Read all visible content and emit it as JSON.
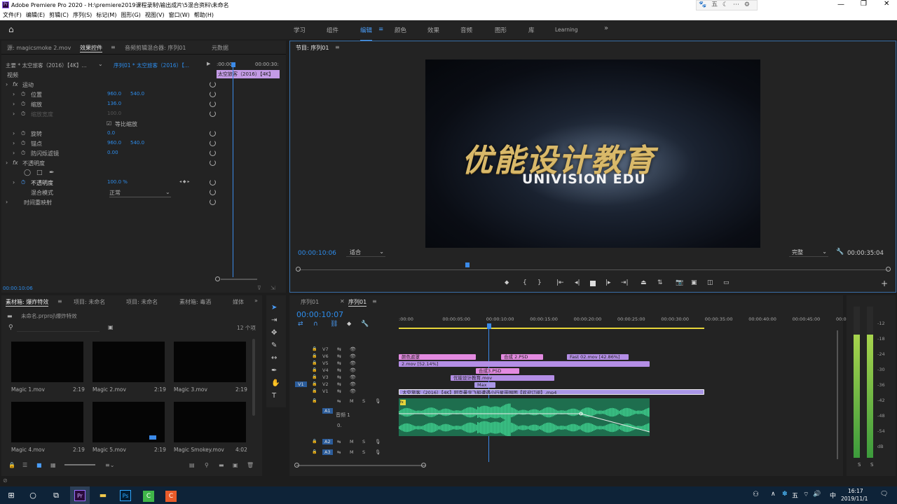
{
  "window": {
    "title": "Adobe Premiere Pro 2020 - H:\\premiere2019课程录制\\输出成片\\5混合资料\\未命名"
  },
  "menu": [
    "文件(F)",
    "编辑(E)",
    "剪辑(C)",
    "序列(S)",
    "标记(M)",
    "图形(G)",
    "视图(V)",
    "窗口(W)",
    "帮助(H)"
  ],
  "workspaces": [
    "学习",
    "组件",
    "编辑",
    "颜色",
    "效果",
    "音频",
    "图形",
    "库",
    "Learning"
  ],
  "active_workspace": "编辑",
  "ec": {
    "tabs": [
      "源: magicsmoke 2.mov",
      "效果控件",
      "音频剪辑混合器: 序列01",
      "元数据"
    ],
    "master": "主要 * 太空旅客（2016）【4K】...",
    "seq": "序列01 * 太空旅客（2016）【...",
    "ruler_start": ":00:00",
    "ruler_end": "00:00:30:",
    "clipbar": "太空旅客（2016）【4K】",
    "section_video": "视频",
    "rows": [
      {
        "label": "运动",
        "fx": true,
        "indent": 0
      },
      {
        "label": "位置",
        "v1": "960.0",
        "v2": "540.0",
        "indent": 1
      },
      {
        "label": "缩放",
        "v1": "136.0",
        "indent": 1
      },
      {
        "label": "缩放宽度",
        "v1": "100.0",
        "indent": 1,
        "dim": true
      },
      {
        "label": "等比缩放",
        "check": true,
        "indent": 2
      },
      {
        "label": "旋转",
        "v1": "0.0",
        "indent": 1
      },
      {
        "label": "锚点",
        "v1": "960.0",
        "v2": "540.0",
        "indent": 1
      },
      {
        "label": "防闪烁滤镜",
        "v1": "0.00",
        "indent": 1
      },
      {
        "label": "不透明度",
        "fx": true,
        "indent": 0
      },
      {
        "label": "",
        "shapes": true,
        "indent": 1
      },
      {
        "label": "不透明度",
        "v1": "100.0 %",
        "indent": 1,
        "kf": true
      },
      {
        "label": "混合模式",
        "select": "正常",
        "indent": 1
      },
      {
        "label": "时间重映射",
        "indent": 0
      }
    ],
    "timecode": "00:00:10:06"
  },
  "program": {
    "tab": "节目: 序列01",
    "timecode": "00:00:10:06",
    "fit": "适合",
    "quality": "完整",
    "duration": "00:00:35:04",
    "title_cn": "优能设计教育",
    "title_en": "UNIVISION EDU"
  },
  "project": {
    "tabs": [
      "素材箱: 爆炸特效",
      "项目: 未命名",
      "项目: 未命名",
      "素材箱: 毒酒",
      "媒体"
    ],
    "path": "未命名.prproj\\爆炸特效",
    "count": "12 个项",
    "items": [
      {
        "name": "Magic 1.mov",
        "dur": "2:19"
      },
      {
        "name": "Magic 2.mov",
        "dur": "2:19"
      },
      {
        "name": "Magic 3.mov",
        "dur": "2:19"
      },
      {
        "name": "Magic 4.mov",
        "dur": "2:19"
      },
      {
        "name": "Magic 5.mov",
        "dur": "2:19"
      },
      {
        "name": "Magic Smokey.mov",
        "dur": "4:02"
      }
    ]
  },
  "timeline": {
    "tabs": [
      "序列01",
      "序列01"
    ],
    "timecode": "00:00:10:07",
    "ruler": [
      ":00:00",
      "00:00:05:00",
      "00:00:10:00",
      "00:00:15:00",
      "00:00:20:00",
      "00:00:25:00",
      "00:00:30:00",
      "00:00:35:00",
      "00:00:40:00",
      "00:00:45:00",
      "00:00"
    ],
    "tracks": [
      "V7",
      "V6",
      "V5",
      "V4",
      "V3",
      "V2",
      "V1",
      "A1",
      "A2",
      "A3"
    ],
    "src_patch": "V1",
    "audio_label": "音频 1",
    "audio_vol": "0.",
    "clips": [
      {
        "t": "颜色遮罩",
        "c": "pink"
      },
      {
        "t": "合成 2.PSD",
        "c": "pink"
      },
      {
        "t": "Fast 02.mov [42.86%]",
        "c": "purple"
      },
      {
        "t": "2.mov [52.14%]",
        "c": "purple"
      },
      {
        "t": "合成3.PSD",
        "c": "pink"
      },
      {
        "t": "优能设计教育.mov",
        "c": "purple"
      },
      {
        "t": "Max",
        "c": "lav"
      },
      {
        "t": "太空旅客（2016）【4K】阿克曼亨飞船遭遇小行星带围困【欢迎订阅】.mp4",
        "c": "lav"
      },
      {
        "t": "fx",
        "c": "a"
      }
    ],
    "meter": [
      "-12",
      "-18",
      "-24",
      "-30",
      "-36",
      "-42",
      "-48",
      "-54",
      "dB"
    ],
    "meter_solo": [
      "S",
      "S"
    ]
  },
  "taskbar": {
    "time": "16:17",
    "date": "2019/11/1"
  },
  "tray_icons": [
    "五",
    "☾",
    "⋯",
    "⚙"
  ]
}
